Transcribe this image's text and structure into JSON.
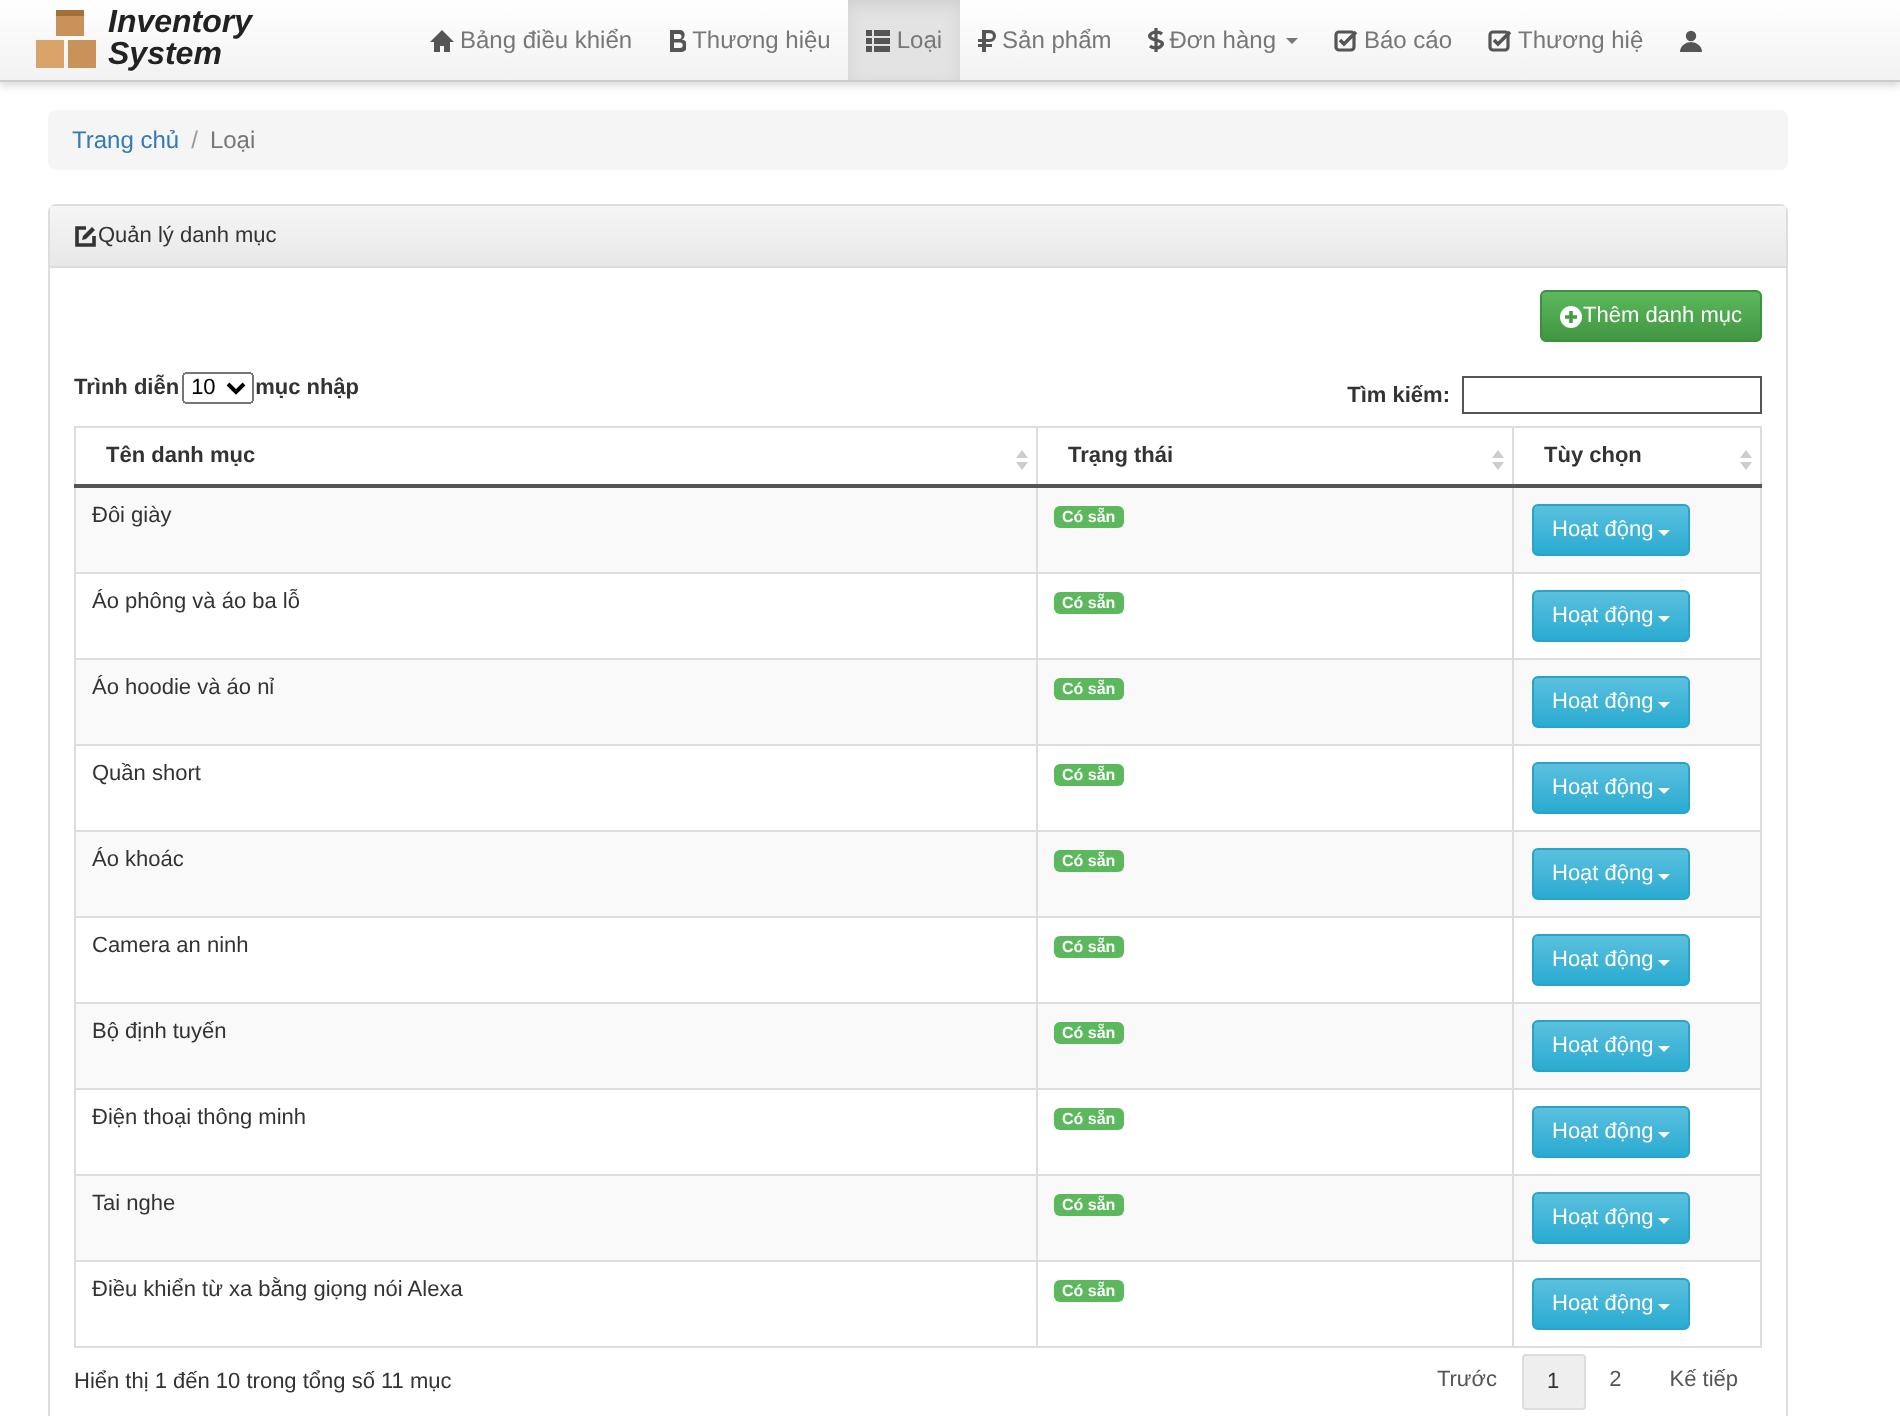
{
  "brand": {
    "line1": "Inventory",
    "line2": "System"
  },
  "nav": [
    {
      "label": "Bảng điều khiển",
      "selected": false,
      "dropdown": false
    },
    {
      "label": "Thương hiệu",
      "selected": false,
      "dropdown": false
    },
    {
      "label": "Loại",
      "selected": true,
      "dropdown": false
    },
    {
      "label": "Sản phẩm",
      "selected": false,
      "dropdown": false
    },
    {
      "label": "Đơn hàng",
      "selected": false,
      "dropdown": true
    },
    {
      "label": "Báo cáo",
      "selected": false,
      "dropdown": false
    },
    {
      "label": "Thương hiệ",
      "selected": false,
      "dropdown": false
    },
    {
      "selected": false,
      "dropdown": false
    }
  ],
  "breadcrumb": [
    {
      "label": "Trang chủ",
      "kind": "link"
    },
    {
      "label": "Loại",
      "kind": "current"
    }
  ],
  "breadcrumb_separator": "/",
  "panel": {
    "title": "Quản lý danh mục",
    "add_button": "Thêm danh mục",
    "length": {
      "before": "Trình diễn",
      "value": "10",
      "after": "mục nhập"
    },
    "search": {
      "label": "Tìm kiếm:"
    },
    "columns": [
      "Tên danh mục",
      "Trạng thái",
      "Tùy chọn"
    ],
    "rows": [
      {
        "name": "Đôi giày",
        "status": "Có sẵn",
        "action": "Hoạt động"
      },
      {
        "name": "Áo phông và áo ba lỗ",
        "status": "Có sẵn",
        "action": "Hoạt động"
      },
      {
        "name": "Áo hoodie và áo nỉ",
        "status": "Có sẵn",
        "action": "Hoạt động"
      },
      {
        "name": "Quần short",
        "status": "Có sẵn",
        "action": "Hoạt động"
      },
      {
        "name": "Áo khoác",
        "status": "Có sẵn",
        "action": "Hoạt động"
      },
      {
        "name": "Camera an ninh",
        "status": "Có sẵn",
        "action": "Hoạt động"
      },
      {
        "name": "Bộ định tuyến",
        "status": "Có sẵn",
        "action": "Hoạt động"
      },
      {
        "name": "Điện thoại thông minh",
        "status": "Có sẵn",
        "action": "Hoạt động"
      },
      {
        "name": "Tai nghe",
        "status": "Có sẵn",
        "action": "Hoạt động"
      },
      {
        "name": "Điều khiển từ xa bằng giọng nói Alexa",
        "status": "Có sẵn",
        "action": "Hoạt động"
      }
    ],
    "info": "Hiển thị 1 đến 10 trong tổng số 11 mục",
    "pagination": [
      {
        "label": "Trước",
        "selected": false
      },
      {
        "label": "1",
        "selected": true
      },
      {
        "label": "2",
        "selected": false
      },
      {
        "label": "Kế tiếp",
        "selected": false
      }
    ]
  }
}
